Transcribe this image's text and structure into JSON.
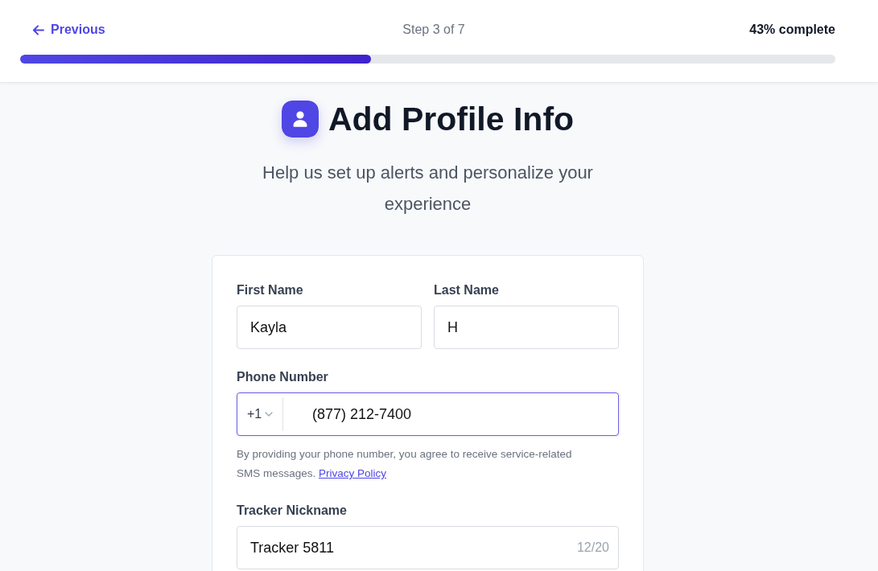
{
  "header": {
    "back_link": "Previous",
    "step": "Step 3 of 7",
    "completion": "43% complete",
    "progress": {
      "level": 0.43
    }
  },
  "heading": {
    "title": "Add Profile Info",
    "subtitle": "Help us set up alerts and personalize your experience"
  },
  "form": {
    "name_fields": [
      {
        "label": "First Name",
        "value": "Kayla"
      },
      {
        "label": "Last Name",
        "value": "H"
      }
    ],
    "phone": {
      "label": "Phone Number",
      "country_code": "+1",
      "value": "(877) 212-7400",
      "focused": true,
      "hint": "By providing your phone number, you agree to receive service-related SMS messages.",
      "hint_link": "Privacy Policy"
    },
    "nickname": {
      "label": "Tracker Nickname",
      "value": "Tracker 5811",
      "counter": "12/20"
    }
  }
}
